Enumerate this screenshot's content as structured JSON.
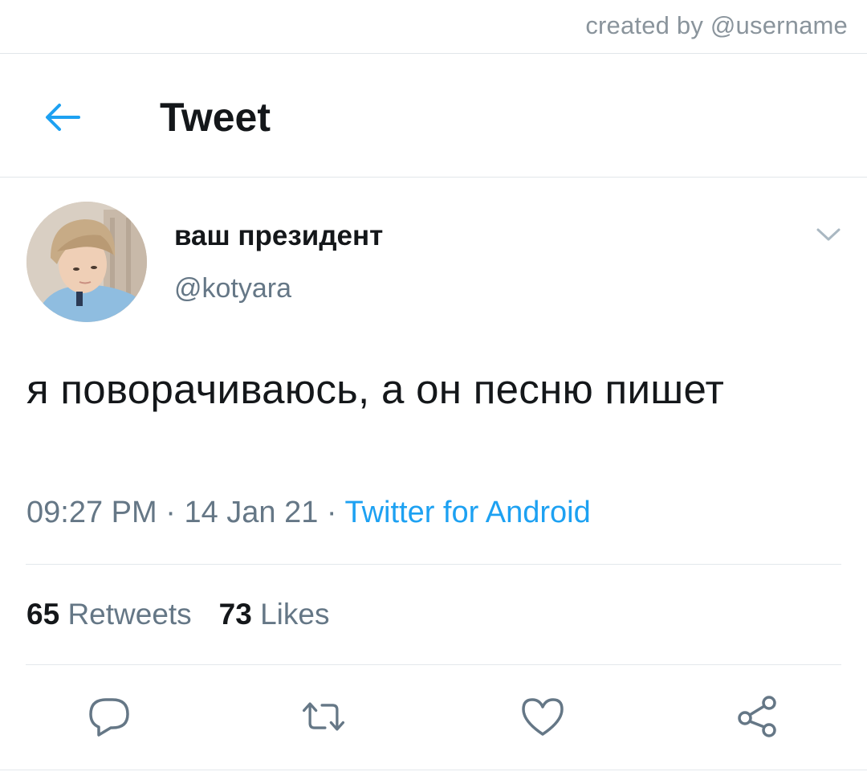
{
  "credit": "created by @username",
  "header": {
    "title": "Tweet",
    "back_icon": "arrow-left-icon",
    "accent_color": "#1da1f2"
  },
  "tweet": {
    "display_name": "ваш президент",
    "handle": "@kotyara",
    "text": "я поворачиваюсь, а он песню пишет",
    "time": "09:27 PM",
    "date": "14 Jan 21",
    "separator": "·",
    "source": "Twitter for Android",
    "retweets_count": "65",
    "retweets_label": "Retweets",
    "likes_count": "73",
    "likes_label": "Likes"
  },
  "actions": [
    {
      "icon": "reply-icon"
    },
    {
      "icon": "retweet-icon"
    },
    {
      "icon": "heart-icon"
    },
    {
      "icon": "share-icon"
    }
  ],
  "colors": {
    "text_primary": "#14171a",
    "text_secondary": "#657786",
    "link": "#1da1f2",
    "divider": "#e1e6ea"
  }
}
